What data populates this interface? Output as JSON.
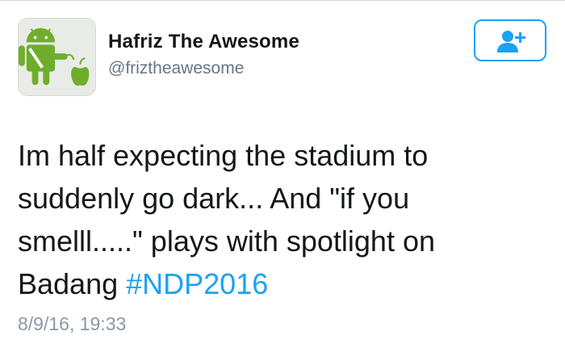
{
  "user": {
    "display_name": "Hafriz The Awesome",
    "handle": "@friztheawesome",
    "avatar_icon": "android-and-apple-avatar"
  },
  "follow_button": {
    "icon": "add-user-icon"
  },
  "tweet": {
    "text_line_1": "Im half expecting the stadium to",
    "text_line_2": "suddenly go dark... And \"if you",
    "text_line_3": "smelll.....\" plays with spotlight on",
    "text_line_4_prefix": "Badang ",
    "hashtag": "#NDP2016",
    "timestamp": "8/9/16, 19:33"
  },
  "colors": {
    "accent": "#1da1f2",
    "text": "#14171a",
    "muted": "#657786",
    "avatar_android": "#6fae2c"
  }
}
